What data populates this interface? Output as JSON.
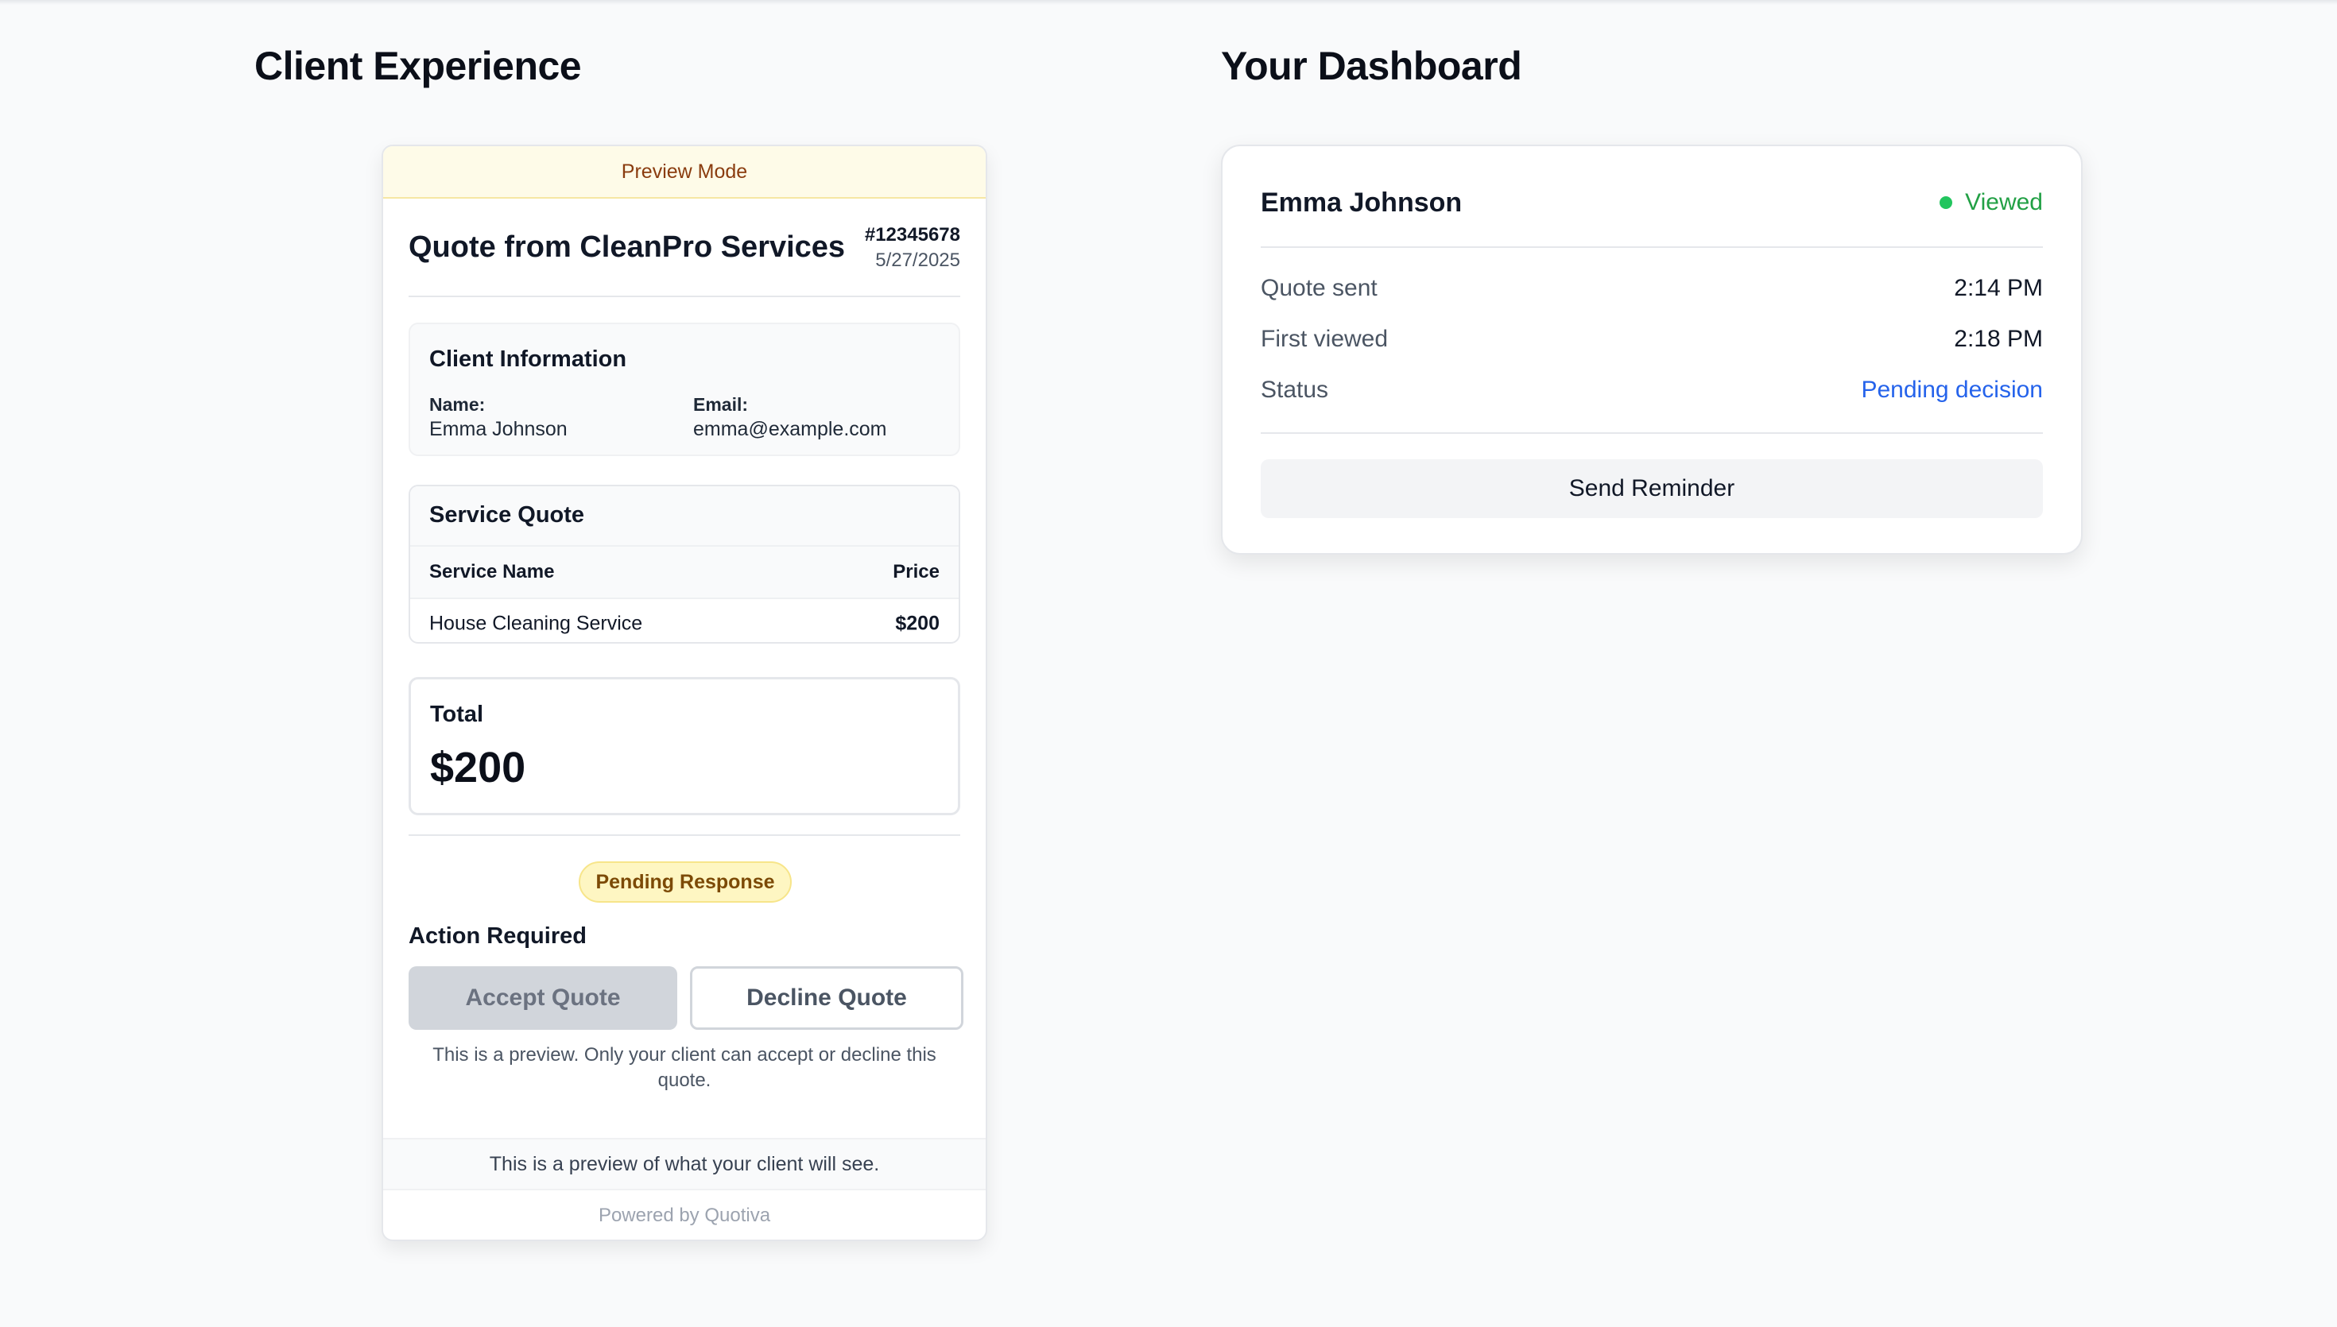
{
  "sections": {
    "client_title": "Client Experience",
    "dashboard_title": "Your Dashboard"
  },
  "quote": {
    "preview_banner": "Preview Mode",
    "title": "Quote from CleanPro Services",
    "number": "#12345678",
    "date": "5/27/2025",
    "client_info": {
      "heading": "Client Information",
      "name_label": "Name:",
      "name_value": "Emma Johnson",
      "email_label": "Email:",
      "email_value": "emma@example.com"
    },
    "service": {
      "heading": "Service Quote",
      "columns": [
        "Service Name",
        "Price"
      ],
      "rows": [
        {
          "name": "House Cleaning Service",
          "price": "$200"
        }
      ]
    },
    "total": {
      "label": "Total",
      "value": "$200"
    },
    "status_badge": "Pending Response",
    "action_label": "Action Required",
    "accept_label": "Accept Quote",
    "decline_label": "Decline Quote",
    "preview_note": "This is a preview. Only your client can accept or decline this quote.",
    "footer_note": "This is a preview of what your client will see.",
    "powered_by": "Powered by Quotiva"
  },
  "dashboard": {
    "client_name": "Emma Johnson",
    "status_label": "Viewed",
    "rows": [
      {
        "label": "Quote sent",
        "value": "2:14 PM"
      },
      {
        "label": "First viewed",
        "value": "2:18 PM"
      },
      {
        "label": "Status",
        "value": "Pending decision"
      }
    ],
    "reminder_label": "Send Reminder"
  },
  "colors": {
    "viewed_green": "#22a045",
    "pending_blue": "#2563eb",
    "banner_yellow": "#fefbe8"
  }
}
